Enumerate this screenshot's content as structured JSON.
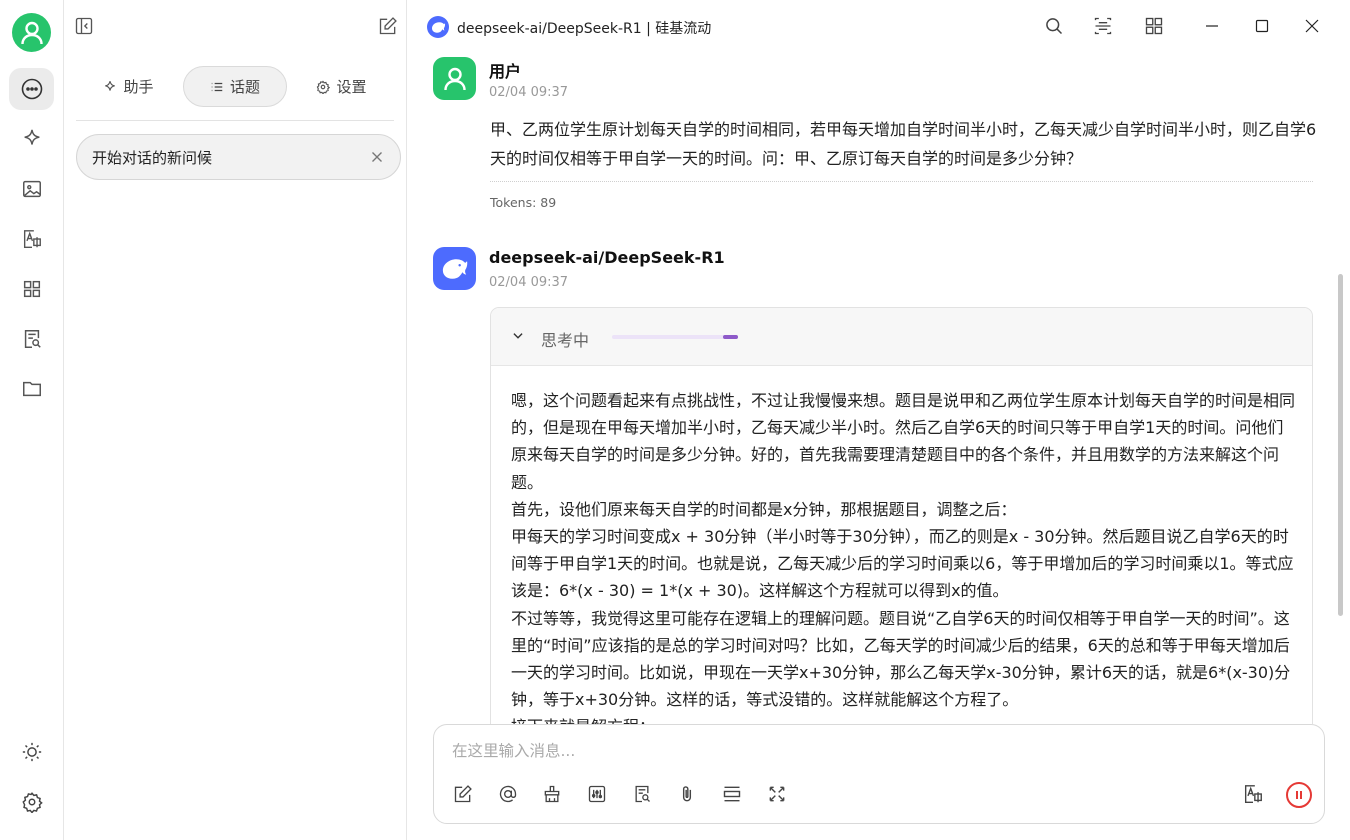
{
  "window": {
    "title": "deepseek-ai/DeepSeek-R1 | 硅基流动"
  },
  "sidebar": {
    "tabs": [
      {
        "label": "助手",
        "icon": "sparkle-icon"
      },
      {
        "label": "话题",
        "icon": "list-icon",
        "active": true
      },
      {
        "label": "设置",
        "icon": "gear-icon"
      }
    ],
    "topics": [
      {
        "label": "开始对话的新问候"
      }
    ]
  },
  "messages": {
    "user": {
      "name": "用户",
      "time": "02/04 09:37",
      "text": "甲、乙两位学生原计划每天自学的时间相同，若甲每天增加自学时间半小时，乙每天减少自学时间半小时，则乙自学6天的时间仅相等于甲自学一天的时间。问：甲、乙原订每天自学的时间是多少分钟？",
      "tokens": "Tokens: 89"
    },
    "assistant": {
      "name": "deepseek-ai/DeepSeek-R1",
      "time": "02/04 09:37",
      "thinking_label": "思考中",
      "thinking_progress": 0.12,
      "thinking_paragraphs": [
        "嗯，这个问题看起来有点挑战性，不过让我慢慢来想。题目是说甲和乙两位学生原本计划每天自学的时间是相同的，但是现在甲每天增加半小时，乙每天减少半小时。然后乙自学6天的时间只等于甲自学1天的时间。问他们原来每天自学的时间是多少分钟。好的，首先我需要理清楚题目中的各个条件，并且用数学的方法来解这个问题。",
        "首先，设他们原来每天自学的时间都是x分钟，那根据题目，调整之后：",
        "甲每天的学习时间变成x + 30分钟（半小时等于30分钟），而乙的则是x - 30分钟。然后题目说乙自学6天的时间等于甲自学1天的时间。也就是说，乙每天减少后的学习时间乘以6，等于甲增加后的学习时间乘以1。等式应该是：6*(x - 30) = 1*(x + 30)。这样解这个方程就可以得到x的值。",
        "不过等等，我觉得这里可能存在逻辑上的理解问题。题目说“乙自学6天的时间仅相等于甲自学一天的时间”。这里的“时间”应该指的是总的学习时间对吗？比如，乙每天学的时间减少后的结果，6天的总和等于甲每天增加后一天的学习时间。比如说，甲现在一天学x+30分钟，那么乙每天学x-30分钟，累计6天的话，就是6*(x-30)分钟，等于x+30分钟。这样的话，等式没错的。这样就能解这个方程了。",
        "接下来就是解方程："
      ]
    }
  },
  "input": {
    "placeholder": "在这里输入消息..."
  },
  "colors": {
    "accent_green": "#27c46c",
    "deepseek_blue": "#4d6bfe",
    "stop_red": "#e53935",
    "thinking_purple": "#8e5ac9"
  }
}
